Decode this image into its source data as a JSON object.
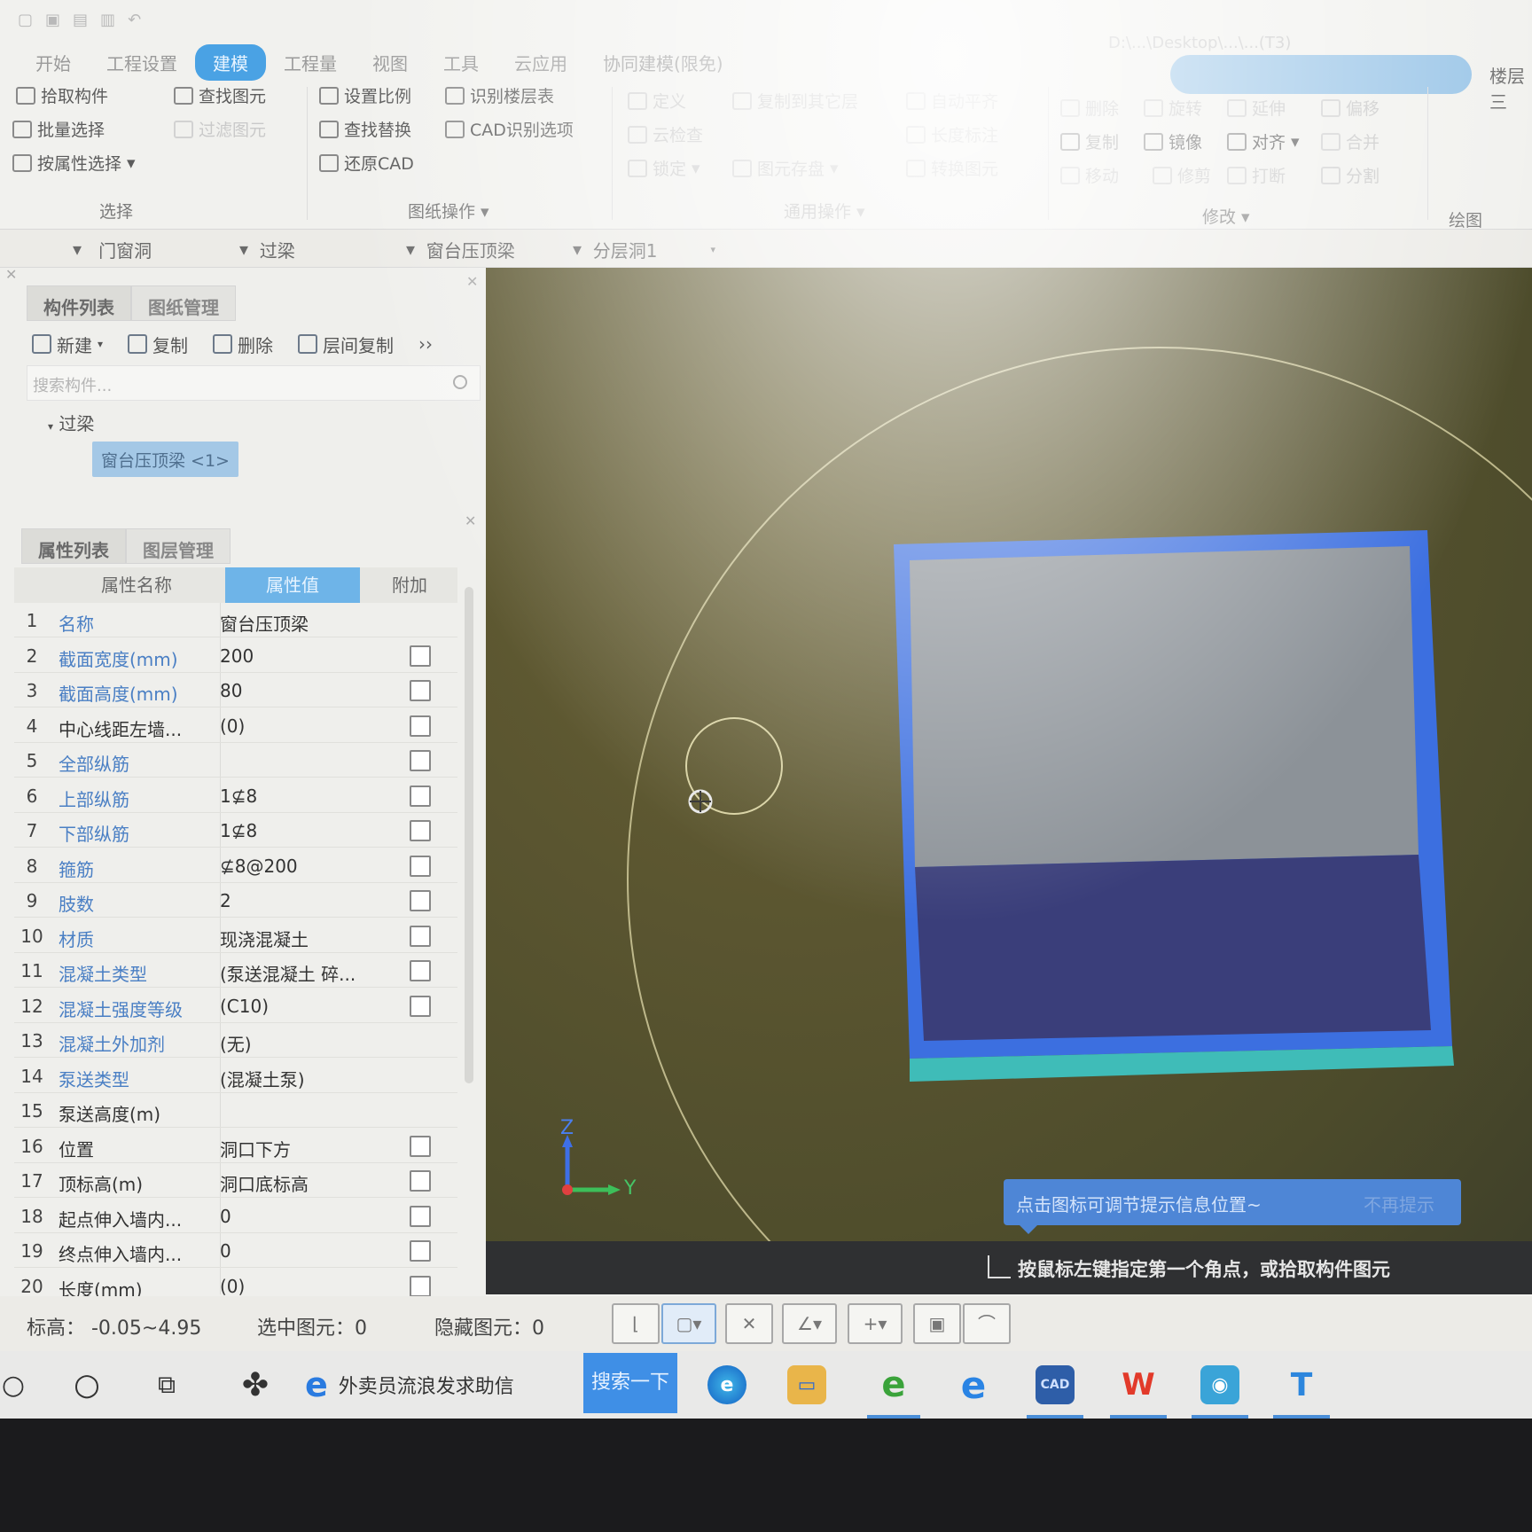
{
  "title_bar": {
    "path_text": "D:\\...\\Desktop\\...\\...(T3)"
  },
  "menu": {
    "tabs": [
      "开始",
      "工程设置",
      "建模",
      "工程量",
      "视图",
      "工具",
      "云应用",
      "协同建模(限免)"
    ],
    "active_tab": "建模",
    "right_label": "楼层三"
  },
  "ribbon": {
    "select_group": {
      "label": "选择",
      "items": [
        "拾取构件",
        "批量选择",
        "按属性选择",
        "查找图元",
        "过滤图元"
      ]
    },
    "drawing_group": {
      "label": "图纸操作",
      "items": [
        "设置比例",
        "查找替换",
        "还原CAD",
        "识别楼层表",
        "CAD识别选项"
      ]
    },
    "common_group": {
      "label": "通用操作",
      "items": [
        "定义",
        "云检查",
        "锁定",
        "复制到其它层",
        "图元存盘",
        "自动平齐",
        "长度标注",
        "转换图元"
      ]
    },
    "modify_group": {
      "label": "修改",
      "items": [
        "删除",
        "复制",
        "移动",
        "旋转",
        "镜像",
        "对齐",
        "延伸",
        "修剪",
        "打断",
        "合并",
        "分割",
        "偏移"
      ]
    },
    "draw_group": {
      "label": "绘图"
    }
  },
  "selectors": [
    {
      "value": "门窗洞"
    },
    {
      "value": "过梁"
    },
    {
      "value": "窗台压顶梁"
    },
    {
      "value": "分层洞1"
    }
  ],
  "component_panel": {
    "tabs": [
      "构件列表",
      "图纸管理"
    ],
    "toolbar": [
      "新建",
      "复制",
      "删除",
      "层间复制"
    ],
    "search_placeholder": "搜索构件...",
    "tree": {
      "root": "过梁",
      "selected_leaf": "窗台压顶梁 <1>"
    }
  },
  "property_panel": {
    "tabs": [
      "属性列表",
      "图层管理"
    ],
    "columns": [
      "属性名称",
      "属性值",
      "附加"
    ],
    "rows": [
      {
        "num": "1",
        "name": "名称",
        "value": "窗台压顶梁",
        "style": "blue",
        "checkbox": false
      },
      {
        "num": "2",
        "name": "截面宽度(mm)",
        "value": "200",
        "style": "blue",
        "checkbox": true
      },
      {
        "num": "3",
        "name": "截面高度(mm)",
        "value": "80",
        "style": "blue",
        "checkbox": true
      },
      {
        "num": "4",
        "name": "中心线距左墙...",
        "value": "(0)",
        "style": "dark",
        "checkbox": true
      },
      {
        "num": "5",
        "name": "全部纵筋",
        "value": "",
        "style": "blue",
        "checkbox": true
      },
      {
        "num": "6",
        "name": "上部纵筋",
        "value": "1⊈8",
        "style": "blue",
        "checkbox": true
      },
      {
        "num": "7",
        "name": "下部纵筋",
        "value": "1⊈8",
        "style": "blue",
        "checkbox": true
      },
      {
        "num": "8",
        "name": "箍筋",
        "value": "⊈8@200",
        "style": "blue",
        "checkbox": true
      },
      {
        "num": "9",
        "name": "肢数",
        "value": "2",
        "style": "blue",
        "checkbox": true
      },
      {
        "num": "10",
        "name": "材质",
        "value": "现浇混凝土",
        "style": "blue",
        "checkbox": true
      },
      {
        "num": "11",
        "name": "混凝土类型",
        "value": "(泵送混凝土 碎...",
        "style": "blue",
        "checkbox": true
      },
      {
        "num": "12",
        "name": "混凝土强度等级",
        "value": "(C10)",
        "style": "blue",
        "checkbox": true
      },
      {
        "num": "13",
        "name": "混凝土外加剂",
        "value": "(无)",
        "style": "blue",
        "checkbox": false
      },
      {
        "num": "14",
        "name": "泵送类型",
        "value": "(混凝土泵)",
        "style": "blue",
        "checkbox": false
      },
      {
        "num": "15",
        "name": "泵送高度(m)",
        "value": "",
        "style": "dark",
        "checkbox": false
      },
      {
        "num": "16",
        "name": "位置",
        "value": "洞口下方",
        "style": "dark",
        "checkbox": true
      },
      {
        "num": "17",
        "name": "顶标高(m)",
        "value": "洞口底标高",
        "style": "dark",
        "checkbox": true
      },
      {
        "num": "18",
        "name": "起点伸入墙内...",
        "value": "0",
        "style": "dark",
        "checkbox": true
      },
      {
        "num": "19",
        "name": "终点伸入墙内...",
        "value": "0",
        "style": "dark",
        "checkbox": true
      },
      {
        "num": "20",
        "name": "长度(mm)",
        "value": "(0)",
        "style": "dark",
        "checkbox": true
      }
    ]
  },
  "canvas": {
    "axis_z": "Z",
    "axis_y": "Y",
    "tip_text": "点击图标可调节提示信息位置~",
    "tip_dismiss": "不再提示",
    "prompt": "按鼠标左键指定第一个角点，或拾取构件图元"
  },
  "status_bar": {
    "elevation": "标高：  -0.05~4.95",
    "selected": "选中图元：0",
    "hidden": "隐藏图元：0"
  },
  "taskbar": {
    "search_text": "外卖员流浪发求助信",
    "search_button": "搜索一下",
    "apps": [
      "edge-icon",
      "file-explorer-icon",
      "ie-icon",
      "edge-legacy-icon",
      "cad-icon",
      "wps-icon",
      "viewer-icon",
      "t-app-icon"
    ]
  },
  "colors": {
    "accent": "#4aa2e4",
    "canvas_bg": "#5a5530",
    "element_blue": "#3c6fe0",
    "element_teal": "#3fbcb8",
    "tip_bg": "#4e86d6"
  }
}
